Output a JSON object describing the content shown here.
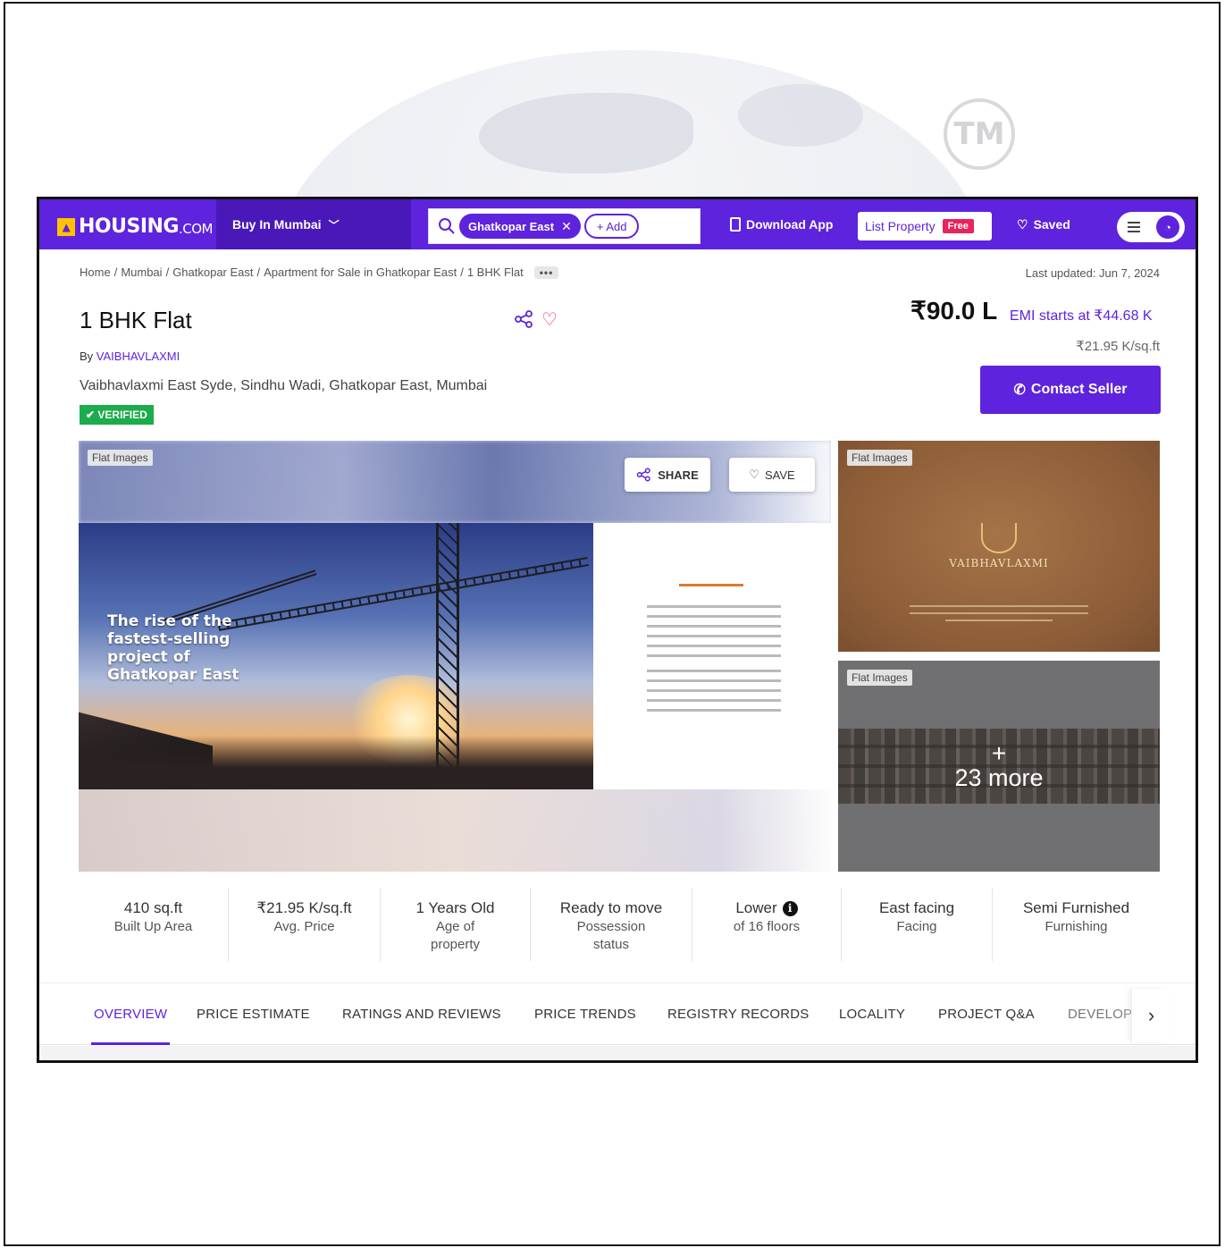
{
  "header": {
    "logo_text": "HOUSING",
    "logo_suffix": ".COM",
    "buy_label": "Buy In Mumbai",
    "search_chip": "Ghatkopar East",
    "add_chip": "+ Add",
    "download_label": "Download App",
    "list_property_label": "List Property",
    "free_tag": "Free",
    "saved_label": "Saved",
    "brand_color": "#5e23dc"
  },
  "breadcrumb": {
    "items": [
      "Home",
      "Mumbai",
      "Ghatkopar East",
      "Apartment for Sale in Ghatkopar East",
      "1 BHK Flat"
    ],
    "more": "•••"
  },
  "last_updated": "Last updated: Jun 7, 2024",
  "listing": {
    "title": "1 BHK Flat",
    "by_prefix": "By",
    "seller": "VAIBHAVLAXMI",
    "address": "Vaibhavlaxmi East Syde, Sindhu Wadi, Ghatkopar East, Mumbai",
    "verified": "VERIFIED",
    "price": "₹90.0 L",
    "emi": "EMI starts at ₹44.68 K",
    "price_per_sqft": "₹21.95 K/sq.ft",
    "contact_label": "Contact Seller"
  },
  "gallery": {
    "main_label": "Flat Images",
    "share_label": "SHARE",
    "save_label": "SAVE",
    "hero_text": [
      "The rise of the",
      "fastest-selling",
      "project of",
      "Ghatkopar East"
    ],
    "thumb1_label": "Flat Images",
    "thumb1_brand": "VAIBHAVLAXMI",
    "thumb2_label": "Flat Images",
    "more_plus": "+",
    "more_text": "23 more"
  },
  "stats": [
    {
      "value": "410 sq.ft",
      "label": "Built Up Area"
    },
    {
      "value": "₹21.95 K/sq.ft",
      "label": "Avg. Price"
    },
    {
      "value": "1 Years Old",
      "label": "Age of property"
    },
    {
      "value": "Ready to move",
      "label": "Possession status"
    },
    {
      "value": "Lower",
      "label": "of 16 floors"
    },
    {
      "value": "East facing",
      "label": "Facing"
    },
    {
      "value": "Semi Furnished",
      "label": "Furnishing"
    }
  ],
  "tabs": [
    "OVERVIEW",
    "PRICE ESTIMATE",
    "RATINGS AND REVIEWS",
    "PRICE TRENDS",
    "REGISTRY RECORDS",
    "LOCALITY",
    "PROJECT Q&A",
    "DEVELOPER"
  ],
  "watermark": {
    "tm": "TM"
  }
}
